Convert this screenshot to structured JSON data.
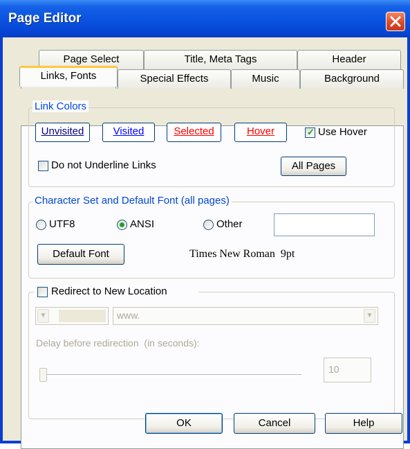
{
  "window": {
    "title": "Page Editor",
    "close_icon": "close-icon"
  },
  "tabs": {
    "row1": [
      "Page Select",
      "Title, Meta Tags",
      "Header"
    ],
    "row2": [
      "Links, Fonts",
      "Special Effects",
      "Music",
      "Background"
    ],
    "active": "Links, Fonts"
  },
  "link_colors": {
    "legend": "Link Colors",
    "unvisited": "Unvisited",
    "visited": "Visited",
    "selected": "Selected",
    "hover": "Hover",
    "use_hover_label": "Use Hover",
    "use_hover_checked": true,
    "no_underline_label": "Do not Underline Links",
    "no_underline_checked": false,
    "all_pages": "All Pages",
    "colors": {
      "unvisited": "#000080",
      "visited": "#0000ff",
      "selected": "#ff0000",
      "hover": "#ff0000"
    }
  },
  "charset": {
    "legend": "Character Set and Default Font (all pages)",
    "utf8": "UTF8",
    "ansi": "ANSI",
    "other": "Other",
    "selected": "ANSI",
    "other_value": "",
    "default_font_button": "Default Font",
    "font_display": "Times New Roman  9pt"
  },
  "redirect": {
    "label": "Redirect to New Location",
    "checked": false,
    "protocol_value": "",
    "url_value": "www.",
    "delay_label": "Delay before redirection  (in seconds):",
    "delay_value": "10"
  },
  "footer": {
    "ok": "OK",
    "cancel": "Cancel",
    "help": "Help"
  }
}
